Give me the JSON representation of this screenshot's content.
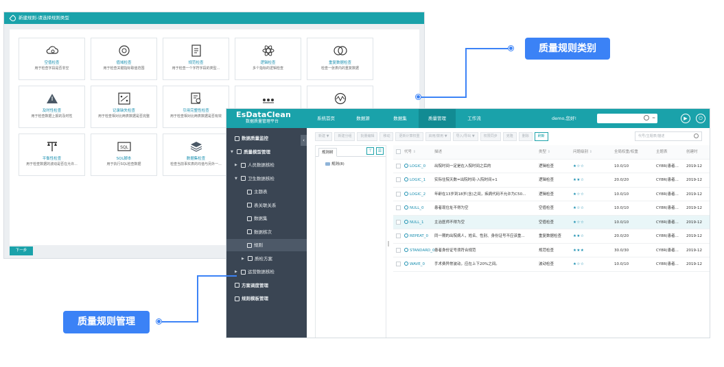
{
  "back_window": {
    "title": "新建规则-请选择规则类型",
    "cards": [
      {
        "name": "空值检查",
        "desc": "用于检查字段是否非空",
        "icon": "cloud-search-icon"
      },
      {
        "name": "值域检查",
        "desc": "用于检查关键指标取值范围",
        "icon": "range-icon"
      },
      {
        "name": "规范检查",
        "desc": "用于检查一个字符字段的类型...",
        "icon": "document-icon"
      },
      {
        "name": "逻辑检查",
        "desc": "多个指标的逻辑检查",
        "icon": "atom-icon"
      },
      {
        "name": "重复数据检查",
        "desc": "检查一张表内的重复数据",
        "icon": "duplicate-icon"
      },
      {
        "name": "及时性检查",
        "desc": "用于检查数据上报的及时性",
        "icon": "timeliness-icon"
      },
      {
        "name": "记录缺失检查",
        "desc": "用于检查相对比两表数据是否完整",
        "icon": "missing-record-icon"
      },
      {
        "name": "引用完整性检查",
        "desc": "用于检查相对比两表数据是否有效",
        "icon": "reference-icon"
      },
      {
        "name": "",
        "desc": "",
        "icon": "dots-icon"
      },
      {
        "name": "",
        "desc": "",
        "icon": "wave-icon"
      },
      {
        "name": "平衡性检查",
        "desc": "用于检查数据的波动是否在允许...",
        "icon": "balance-icon"
      },
      {
        "name": "SQL脚本",
        "desc": "用于执行SQL检查数据",
        "icon": "sql-icon"
      },
      {
        "name": "数据集检查",
        "desc": "检查当前事实表的均值与另外一...",
        "icon": "layers-icon"
      }
    ],
    "next_label": "下一步"
  },
  "app": {
    "brand": "EsDataClean",
    "brand_sub": "数据质量管理平台",
    "nav": [
      "系统首页",
      "数据源",
      "数据集",
      "质量管理",
      "工作流"
    ],
    "active_nav": 3,
    "greeting": "demo,您好!",
    "search_close": "≈",
    "sidebar": [
      {
        "label": "数据质量监控",
        "caret": "",
        "indent": 12,
        "bold": true
      },
      {
        "label": "质量模型管理",
        "caret": "▼",
        "indent": 6,
        "bold": true
      },
      {
        "label": "人员数据核检",
        "caret": "▶",
        "indent": 12,
        "bold": false
      },
      {
        "label": "卫生数据核检",
        "caret": "▼",
        "indent": 12,
        "bold": false
      },
      {
        "label": "主题表",
        "caret": "",
        "indent": 30,
        "bold": false
      },
      {
        "label": "表关联关系",
        "caret": "",
        "indent": 30,
        "bold": false
      },
      {
        "label": "数据集",
        "caret": "",
        "indent": 30,
        "bold": false
      },
      {
        "label": "数据核次",
        "caret": "",
        "indent": 30,
        "bold": false
      },
      {
        "label": "规则",
        "caret": "",
        "indent": 30,
        "bold": false
      },
      {
        "label": "质检方案",
        "caret": "▶",
        "indent": 22,
        "bold": false
      },
      {
        "label": "运营数据核检",
        "caret": "▶",
        "indent": 12,
        "bold": false
      },
      {
        "label": "方案调度管理",
        "caret": "",
        "indent": 12,
        "bold": true
      },
      {
        "label": "规则模板管理",
        "caret": "",
        "indent": 12,
        "bold": true
      }
    ],
    "selected_sidebar": 8,
    "toolbar": [
      "新建 ▼",
      "新建分组",
      "批量编辑",
      "移动",
      "更新计算权重",
      "启用/禁用 ▼",
      "导入/导出 ▼",
      "权限同步",
      "克隆",
      "删除",
      "刷新"
    ],
    "filter_placeholder": "代号/主题表/描述",
    "tree_tab": "规则树",
    "tree_node": "规则(8)",
    "columns": [
      "代号",
      "描述",
      "类型",
      "问题级别",
      "全局权重/权重",
      "主题表",
      "创建时"
    ],
    "rows": [
      {
        "code": "LOGIC_0",
        "desc": "出院时间一定是在入院时间之后的",
        "type": "逻辑检查",
        "stars": "★☆☆",
        "weight": "10.0/10",
        "table": "CY8R(患者...",
        "created": "2019-12"
      },
      {
        "code": "LOGIC_1",
        "desc": "实际住院天数=出院时间-入院时间+1",
        "type": "逻辑检查",
        "stars": "★★☆",
        "weight": "20.0/20",
        "table": "CY8R(患者...",
        "created": "2019-12"
      },
      {
        "code": "LOGIC_2",
        "desc": "年龄在13岁到18岁(含)之间，疾病代码不允许为C50...",
        "type": "逻辑检查",
        "stars": "★☆☆",
        "weight": "10.0/10",
        "table": "CY8R(患者...",
        "created": "2019-12"
      },
      {
        "code": "NULL_0",
        "desc": "患者现住址不得为空",
        "type": "空值检查",
        "stars": "★☆☆",
        "weight": "10.0/10",
        "table": "CY8R(患者...",
        "created": "2019-12"
      },
      {
        "code": "NULL_1",
        "desc": "主治医师不得为空",
        "type": "空值检查",
        "stars": "★☆☆",
        "weight": "10.0/10",
        "table": "CY8R(患者...",
        "created": "2019-12"
      },
      {
        "code": "REPEAT_0",
        "desc": "同一期的出院病人，姓名、性别、身份证号不应该重...",
        "type": "重复数据检查",
        "stars": "★★☆",
        "weight": "20.0/20",
        "table": "CY8R(患者...",
        "created": "2019-12"
      },
      {
        "code": "STANDARD_0",
        "desc": "患者身份证号须符合规范",
        "type": "规范检查",
        "stars": "★★★",
        "weight": "30.0/30",
        "table": "CY8R(患者...",
        "created": "2019-12"
      },
      {
        "code": "WAVE_0",
        "desc": "手术费异常波动，应在上下20%之间。",
        "type": "波动检查",
        "stars": "★☆☆",
        "weight": "10.0/10",
        "table": "CY8R(患者...",
        "created": "2019-12"
      }
    ],
    "highlighted_row": 4
  },
  "callouts": {
    "category": "质量规则类别",
    "management": "质量规则管理"
  },
  "colors": {
    "teal": "#1aa2aa",
    "sidebar": "#3a4553",
    "callout": "#3b82f6"
  }
}
